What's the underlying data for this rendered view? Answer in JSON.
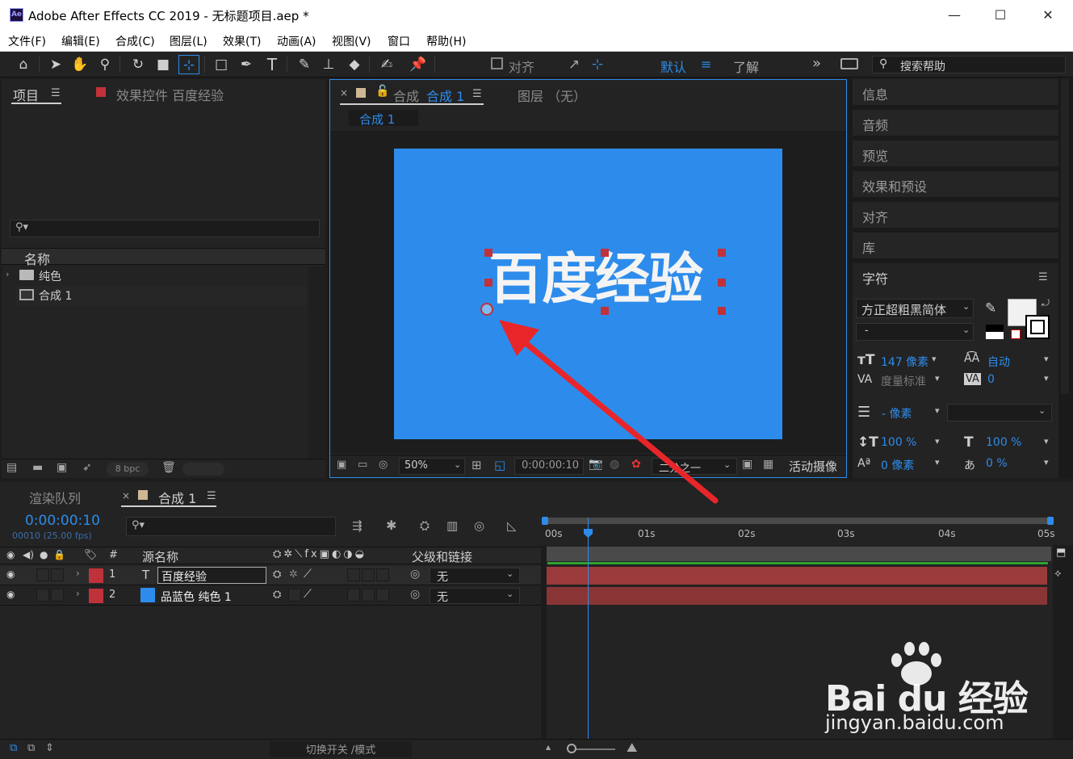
{
  "window": {
    "app_icon": "Ae",
    "title": "Adobe After Effects CC 2019 - 无标题项目.aep *",
    "minimize": "—",
    "maximize": "☐",
    "close": "✕"
  },
  "menu": [
    "文件(F)",
    "编辑(E)",
    "合成(C)",
    "图层(L)",
    "效果(T)",
    "动画(A)",
    "视图(V)",
    "窗口",
    "帮助(H)"
  ],
  "toolbar": {
    "snap_label": "对齐",
    "workspace_default": "默认",
    "workspace_learn": "了解",
    "overflow": "»",
    "search_placeholder": "搜索帮助"
  },
  "project_panel": {
    "tab_project": "项目",
    "tab_effects": "效果控件 百度经验",
    "column_name": "名称",
    "items": [
      {
        "name": "纯色",
        "type": "folder"
      },
      {
        "name": "合成 1",
        "type": "composition"
      }
    ],
    "bit_depth": "8 bpc"
  },
  "comp_panel": {
    "tab_close": "×",
    "tab_label": "合成",
    "tab_name": "合成 1",
    "tab_layer": "图层 （无）",
    "breadcrumb": "合成 1",
    "canvas_text": "百度经验",
    "canvas_color": "#2d8ceb",
    "zoom": "50%",
    "timecode": "0:00:00:10",
    "resolution": "二分之一",
    "camera": "活动摄像"
  },
  "right_panel": {
    "items": [
      "信息",
      "音频",
      "预览",
      "效果和预设",
      "对齐",
      "库"
    ],
    "character": {
      "title": "字符",
      "font_family": "方正超粗黑简体",
      "font_style": "-",
      "font_size": "147 像素",
      "leading": "自动",
      "kerning": "度量标准",
      "tracking": "0",
      "stroke_width": "- 像素",
      "vertical_scale": "100 %",
      "horizontal_scale": "100 %",
      "baseline_shift": "0 像素",
      "tsume": "0 %"
    }
  },
  "timeline": {
    "tab_render_queue": "渲染队列",
    "tab_comp": "合成 1",
    "timecode": "0:00:00:10",
    "frame_info": "00010 (25.00 fps)",
    "columns": {
      "index": "#",
      "source_name": "源名称",
      "parent": "父级和链接"
    },
    "ruler": [
      "00s",
      "01s",
      "02s",
      "03s",
      "04s",
      "05s"
    ],
    "layers": [
      {
        "index": "1",
        "type": "T",
        "name": "百度经验",
        "color": "#c0323a",
        "parent": "无"
      },
      {
        "index": "2",
        "type": "solid",
        "name": "品蓝色 纯色 1",
        "color": "#c0323a",
        "parent": "无"
      }
    ],
    "toggle_label": "切换开关 /模式"
  },
  "watermark": {
    "brand": "Bai du 经验",
    "url": "jingyan.baidu.com"
  }
}
